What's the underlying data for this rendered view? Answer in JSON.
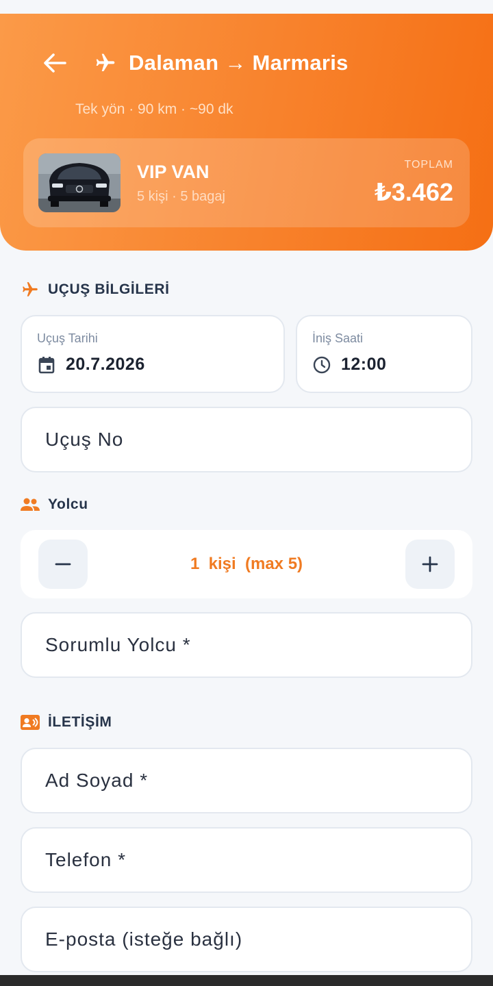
{
  "header": {
    "route_title": "Dalaman → Marmaris",
    "route_subtitle": "Tek yön · 90 km · ~90 dk"
  },
  "vehicle": {
    "name": "VIP VAN",
    "capacity": "5 kişi · 5 bagaj",
    "total_label": "TOPLAM",
    "total_price": "₺3.462"
  },
  "flight_section": {
    "title": "UÇUŞ BİLGİLERİ",
    "date_label": "Uçuş Tarihi",
    "date_value": "20.7.2026",
    "time_label": "İniş Saati",
    "time_value": "12:00",
    "flight_no_placeholder": "Uçuş No"
  },
  "passenger_section": {
    "title": "Yolcu",
    "count_text": "1  kişi  (max 5)",
    "responsible_placeholder": "Sorumlu Yolcu *"
  },
  "contact_section": {
    "title": "İLETİŞİM",
    "name_placeholder": "Ad Soyad *",
    "phone_placeholder": "Telefon *",
    "email_placeholder": "E-posta (isteğe bağlı)"
  },
  "colors": {
    "accent": "#f07b22",
    "header_start": "#fb9a48",
    "header_end": "#f56f14",
    "background": "#f5f7fa"
  },
  "icons": [
    "back-arrow-icon",
    "airplane-icon",
    "calendar-icon",
    "clock-icon",
    "people-icon",
    "contact-card-icon",
    "minus-icon",
    "plus-icon"
  ]
}
